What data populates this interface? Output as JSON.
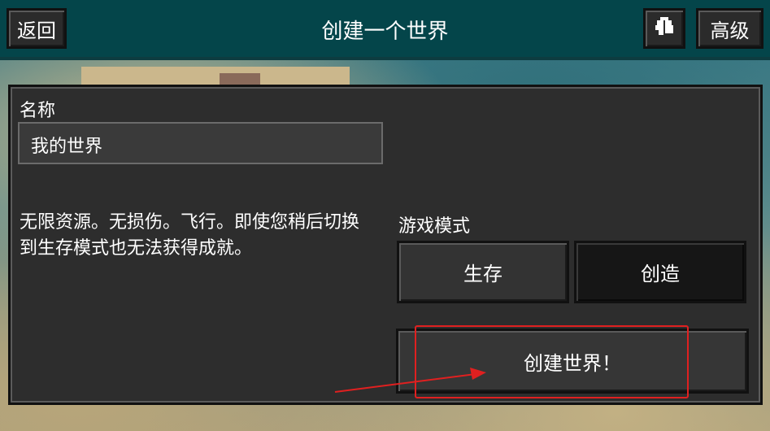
{
  "header": {
    "back_label": "返回",
    "title": "创建一个世界",
    "advanced_label": "高级",
    "icon": "gift-icon"
  },
  "form": {
    "name_label": "名称",
    "name_value": "我的世界",
    "description": "无限资源。无损伤。飞行。即使您稍后切换到生存模式也无法获得成就。",
    "game_mode_label": "游戏模式",
    "modes": [
      "生存",
      "创造"
    ],
    "selected_mode": "创造",
    "create_label": "创建世界！"
  },
  "annotation": {
    "color": "#e02020"
  }
}
